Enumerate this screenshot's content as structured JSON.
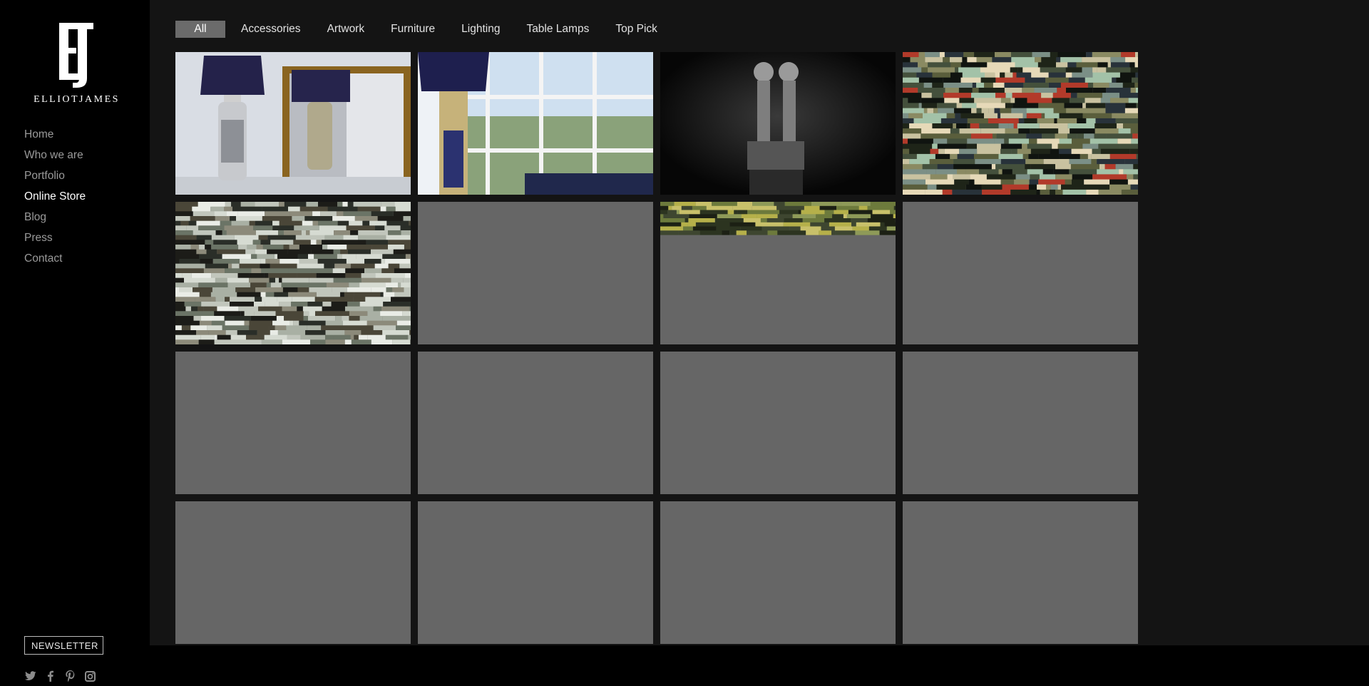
{
  "brand": {
    "monogram": "EJ",
    "wordmark": "ELLIOTJAMES"
  },
  "nav": {
    "items": [
      {
        "label": "Home",
        "active": false
      },
      {
        "label": "Who we are",
        "active": false
      },
      {
        "label": "Portfolio",
        "active": false
      },
      {
        "label": "Online Store",
        "active": true
      },
      {
        "label": "Blog",
        "active": false
      },
      {
        "label": "Press",
        "active": false
      },
      {
        "label": "Contact",
        "active": false
      }
    ]
  },
  "newsletter": {
    "label": "NEWSLETTER"
  },
  "social": [
    "twitter-icon",
    "facebook-icon",
    "pinterest-icon",
    "instagram-icon"
  ],
  "filters": [
    {
      "label": "All",
      "active": true
    },
    {
      "label": "Accessories",
      "active": false
    },
    {
      "label": "Artwork",
      "active": false
    },
    {
      "label": "Furniture",
      "active": false
    },
    {
      "label": "Lighting",
      "active": false
    },
    {
      "label": "Table Lamps",
      "active": false
    },
    {
      "label": "Top Pick",
      "active": false
    }
  ],
  "products": [
    {
      "image": "table-lamps-mirror",
      "loaded": true
    },
    {
      "image": "lamp-window",
      "loaded": true
    },
    {
      "image": "twin-lamp-sculpture",
      "loaded": true
    },
    {
      "image": "abstract-art-colour",
      "loaded": true
    },
    {
      "image": "abstract-art-grey",
      "loaded": true
    },
    {
      "image": "placeholder",
      "loaded": false
    },
    {
      "image": "abstract-art-partial",
      "loaded": false
    },
    {
      "image": "placeholder",
      "loaded": false
    },
    {
      "image": "placeholder",
      "loaded": false
    },
    {
      "image": "placeholder",
      "loaded": false
    },
    {
      "image": "placeholder",
      "loaded": false
    },
    {
      "image": "placeholder",
      "loaded": false
    },
    {
      "image": "placeholder",
      "loaded": false
    },
    {
      "image": "placeholder",
      "loaded": false
    },
    {
      "image": "placeholder",
      "loaded": false
    },
    {
      "image": "placeholder",
      "loaded": false
    }
  ],
  "colors": {
    "sidebar": "#000000",
    "content": "#141414",
    "placeholder": "#666666",
    "active_filter": "#6b6b6b"
  }
}
